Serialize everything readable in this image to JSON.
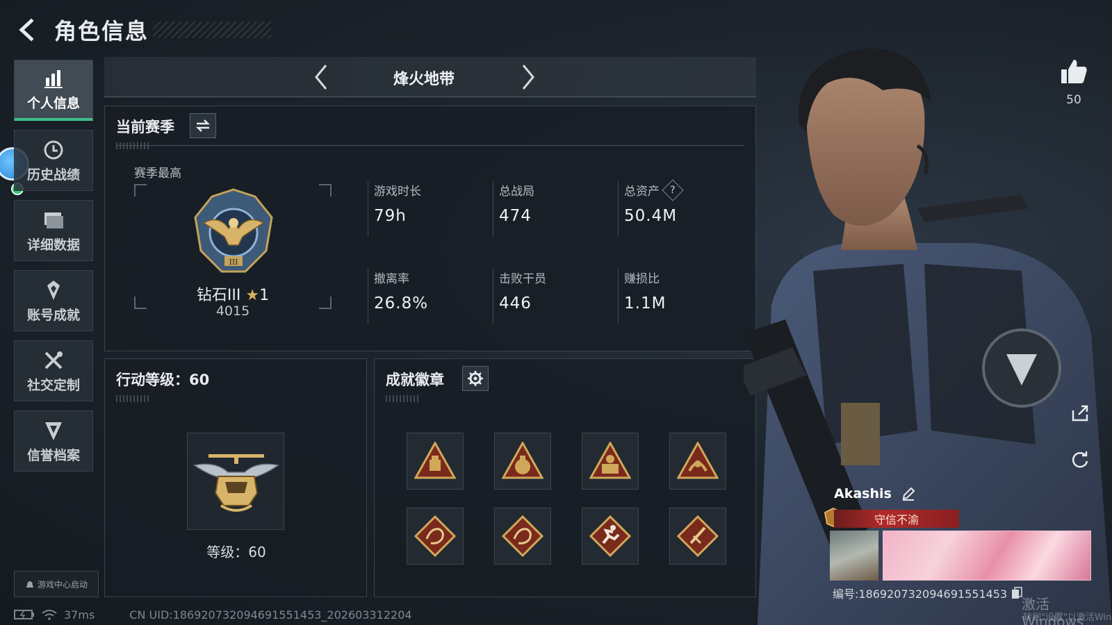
{
  "header": {
    "title": "角色信息"
  },
  "sidebar": {
    "items": [
      {
        "label": "个人信息",
        "icon": "bar-chart-icon",
        "active": true
      },
      {
        "label": "历史战绩",
        "icon": "history-clock-icon",
        "active": false
      },
      {
        "label": "详细数据",
        "icon": "folder-icon",
        "active": false
      },
      {
        "label": "账号成就",
        "icon": "achievement-icon",
        "active": false
      },
      {
        "label": "社交定制",
        "icon": "tools-icon",
        "active": false
      },
      {
        "label": "信誉档案",
        "icon": "credit-shield-icon",
        "active": false
      }
    ],
    "launch_label": "游戏中心启动"
  },
  "mode": {
    "title": "烽火地带"
  },
  "season": {
    "heading": "当前赛季",
    "best_label": "赛季最高",
    "rank_name": "钻石III",
    "rank_star_count": "1",
    "rank_score": "4015",
    "stats": [
      {
        "label": "游戏时长",
        "value": "79h"
      },
      {
        "label": "总战局",
        "value": "474"
      },
      {
        "label": "总资产",
        "value": "50.4M",
        "help": "?"
      },
      {
        "label": "撤离率",
        "value": "26.8%"
      },
      {
        "label": "击败干员",
        "value": "446"
      },
      {
        "label": "赚损比",
        "value": "1.1M"
      }
    ]
  },
  "action_level": {
    "heading": "行动等级：60",
    "level_text": "等级：60"
  },
  "badges": {
    "heading": "成就徽章",
    "items": [
      {
        "icon": "supply-crate-badge-icon"
      },
      {
        "icon": "money-bag-badge-icon"
      },
      {
        "icon": "s6-badge-icon"
      },
      {
        "icon": "laurel-badge-icon"
      },
      {
        "icon": "dragon-badge-icon"
      },
      {
        "icon": "dragon-badge-icon"
      },
      {
        "icon": "runner-badge-icon"
      },
      {
        "icon": "knife-badge-icon"
      }
    ]
  },
  "character": {
    "like_count": "50",
    "player_name": "Akashis",
    "player_title": "守信不渝",
    "player_id": "编号:1869207320946915514​53"
  },
  "status_bar": {
    "ping": "37ms",
    "uid": "CN UID:186920732094691551453_202603312204"
  },
  "watermark": {
    "line1": "激活 Windows",
    "line2": "转到\"设置\"以激活Windows。"
  },
  "colors": {
    "accent_green": "#3fbf8a",
    "title_red": "#b02a2a",
    "rank_gold": "#d9b25a"
  }
}
